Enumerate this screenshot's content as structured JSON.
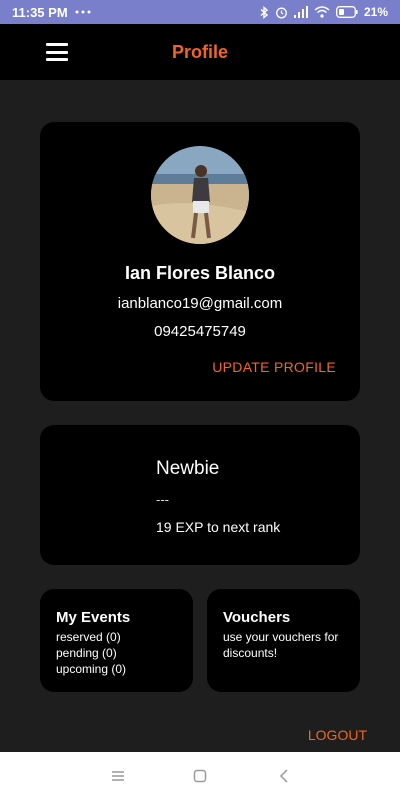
{
  "status_bar": {
    "time": "11:35 PM",
    "battery_percent": "21%",
    "background_color": "#7a7fcc"
  },
  "app_bar": {
    "title": "Profile",
    "menu_icon": "hamburger-menu-icon",
    "title_color": "#f26522"
  },
  "profile": {
    "name": "Ian Flores Blanco",
    "email": "ianblanco19@gmail.com",
    "phone": "09425475749",
    "update_label": "UPDATE PROFILE"
  },
  "rank": {
    "name": "Newbie",
    "progress": "---",
    "exp_to_next": "19 EXP to next rank"
  },
  "events": {
    "title": "My Events",
    "reserved": "reserved (0)",
    "pending": "pending (0)",
    "upcoming": "upcoming (0)"
  },
  "vouchers": {
    "title": "Vouchers",
    "description": "use your vouchers for discounts!"
  },
  "logout_label": "LOGOUT",
  "accent_color": "#f26522",
  "nav_bar": {
    "icons": [
      "recents-icon",
      "home-icon",
      "back-icon"
    ]
  }
}
